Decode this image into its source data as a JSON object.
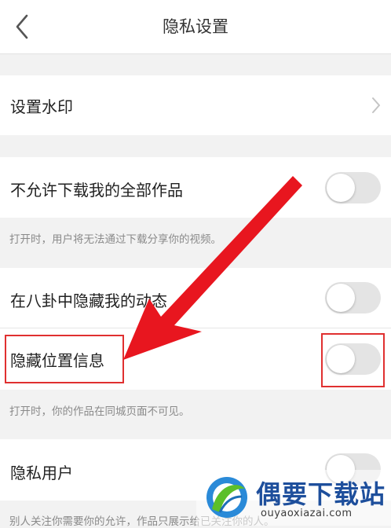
{
  "header": {
    "title": "隐私设置"
  },
  "rows": {
    "watermark": {
      "label": "设置水印"
    },
    "no_download": {
      "label": "不允许下载我的全部作品",
      "hint": "打开时，用户将无法通过下载分享你的视频。",
      "toggle_on": false
    },
    "hide_gossip": {
      "label": "在八卦中隐藏我的动态",
      "toggle_on": false
    },
    "hide_location": {
      "label": "隐藏位置信息",
      "hint": "打开时，你的作品在同城页面不可见。",
      "toggle_on": false
    },
    "private_user": {
      "label": "隐私用户",
      "hint": "别人关注你需要你的允许，作品只展示给已关注你的人。",
      "toggle_on": false
    }
  },
  "watermark_logo": {
    "name": "偶要下载站",
    "url": "ouyaoxiazai.com"
  },
  "colors": {
    "highlight": "#e03030",
    "toggle_off": "#e4e4e4",
    "background": "#f2f2f2"
  }
}
